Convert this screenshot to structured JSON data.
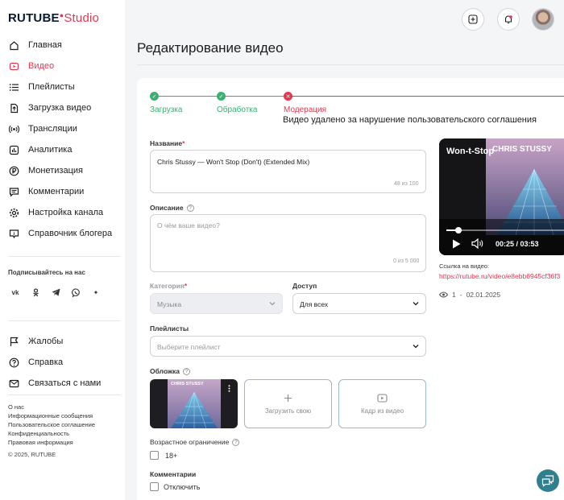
{
  "app": {
    "logo_main": "RUTUBE",
    "logo_sub": "Studio"
  },
  "sidebar": {
    "items": [
      {
        "label": "Главная",
        "icon": "home-icon",
        "active": false
      },
      {
        "label": "Видео",
        "icon": "video-icon",
        "active": true
      },
      {
        "label": "Плейлисты",
        "icon": "playlist-icon",
        "active": false
      },
      {
        "label": "Загрузка видео",
        "icon": "upload-icon",
        "active": false
      },
      {
        "label": "Трансляции",
        "icon": "broadcast-icon",
        "active": false
      },
      {
        "label": "Аналитика",
        "icon": "analytics-icon",
        "active": false
      },
      {
        "label": "Монетизация",
        "icon": "monetization-icon",
        "active": false
      },
      {
        "label": "Комментарии",
        "icon": "comments-icon",
        "active": false
      },
      {
        "label": "Настройка канала",
        "icon": "settings-icon",
        "active": false
      },
      {
        "label": "Справочник блогера",
        "icon": "info-icon",
        "active": false
      }
    ],
    "subscribe_heading": "Подписывайтесь на нас",
    "socials": [
      "vk-icon",
      "ok-icon",
      "telegram-icon",
      "viber-icon",
      "plus-icon"
    ],
    "bottom_items": [
      {
        "label": "Жалобы",
        "icon": "flag-icon"
      },
      {
        "label": "Справка",
        "icon": "help-icon"
      },
      {
        "label": "Связаться с нами",
        "icon": "mail-icon"
      }
    ],
    "footer_links": [
      "О нас",
      "Информационные сообщения",
      "Пользовательское соглашение",
      "Конфиденциальность",
      "Правовая информация"
    ],
    "copyright": "© 2025, RUTUBE"
  },
  "header": {
    "title": "Редактирование видео"
  },
  "steps": [
    {
      "label": "Загрузка",
      "status": "done",
      "color": "#3dae72"
    },
    {
      "label": "Обработка",
      "status": "done",
      "color": "#3dae72"
    },
    {
      "label": "Модерация",
      "status": "error",
      "color": "#e8364f"
    }
  ],
  "moderation_message": "Видео удалено за нарушение пользовательского соглашения",
  "form": {
    "title_label": "Название",
    "title_value": "Chris Stussy — Won't Stop (Don't) (Extended Mix)",
    "title_counter": "48 из 100",
    "description_label": "Описание",
    "description_placeholder": "О чём ваше видео?",
    "description_counter": "0 из 5 000",
    "category_label": "Категория",
    "category_value": "Музыка",
    "access_label": "Доступ",
    "access_value": "Для всех",
    "playlists_label": "Плейлисты",
    "playlists_placeholder": "Выберите плейлист",
    "cover_label": "Обложка",
    "cover_thumb_text": "CHRIS STUSSY",
    "upload_own_label": "Загрузить свою",
    "frame_from_video_label": "Кадр из видео",
    "age_label": "Возрастное ограничение",
    "age_option": "18+",
    "comments_label": "Комментарии",
    "comments_option": "Отключить"
  },
  "player": {
    "title": "Won-t-Stop",
    "artist_text": "CHRIS STUSSY",
    "time": "00:25 / 03:53",
    "progress": 0.1
  },
  "video_link": {
    "label": "Ссылка на видео:",
    "url": "https://rutube.ru/video/e8ebb6945cf36f3"
  },
  "stats": {
    "views": "1",
    "separator": "-",
    "date": "02.01.2025"
  },
  "colors": {
    "accent": "#e8364f",
    "success": "#3dae72",
    "chat_fab": "#2f7f8e"
  }
}
